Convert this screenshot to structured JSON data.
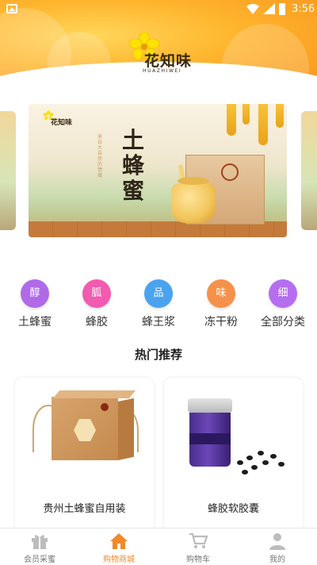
{
  "status_bar": {
    "time": "3:56"
  },
  "header": {
    "logo_text": "花知味",
    "logo_subtext": "HUAZHIWEI"
  },
  "banner": {
    "brand_text": "花知味",
    "title_line1": "土",
    "title_line2": "蜂",
    "title_line3": "蜜",
    "subtitle_vertical": "来自大自然的馈赠"
  },
  "categories": [
    {
      "icon_char": "醇",
      "label": "土蜂蜜",
      "color": "#b06ae8"
    },
    {
      "icon_char": "胍",
      "label": "蜂胶",
      "color": "#f25bb0"
    },
    {
      "icon_char": "品",
      "label": "蜂王浆",
      "color": "#4aa3ef"
    },
    {
      "icon_char": "味",
      "label": "冻干粉",
      "color": "#f6914b"
    },
    {
      "icon_char": "细",
      "label": "全部分类",
      "color": "#b56ef0"
    }
  ],
  "hot_section": {
    "title": "热门推荐"
  },
  "products": [
    {
      "name": "贵州土蜂蜜自用装"
    },
    {
      "name": "蜂胶软胶囊"
    }
  ],
  "tabbar": {
    "tabs": [
      {
        "label": "会员采蜜",
        "icon": "gift-icon"
      },
      {
        "label": "购物商城",
        "icon": "home-icon"
      },
      {
        "label": "购物车",
        "icon": "cart-icon"
      },
      {
        "label": "我的",
        "icon": "user-icon"
      }
    ],
    "active_index": 1,
    "active_color": "#f08a2c",
    "inactive_color": "#bdbdbd"
  }
}
